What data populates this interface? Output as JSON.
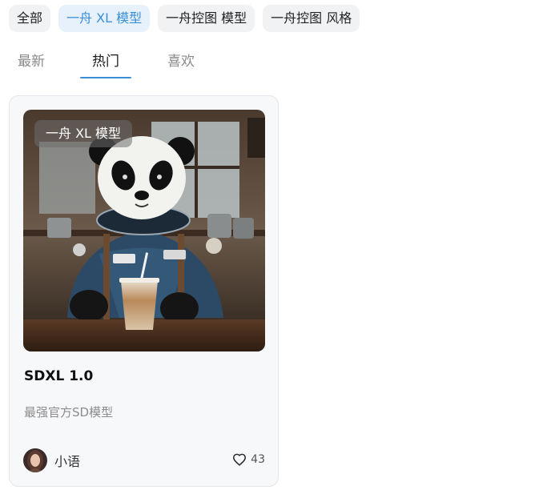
{
  "filters": {
    "chips": [
      {
        "label": "全部"
      },
      {
        "label": "一舟 XL 模型",
        "active": true
      },
      {
        "label": "一舟控图 模型"
      },
      {
        "label": "一舟控图 风格"
      }
    ]
  },
  "tabs": [
    {
      "label": "最新"
    },
    {
      "label": "热门",
      "active": true
    },
    {
      "label": "喜欢"
    }
  ],
  "card": {
    "badge": "一舟 XL 模型",
    "image_icon": "panda-astronaut-image",
    "title": "SDXL 1.0",
    "description": "最强官方SD模型",
    "author": {
      "name": "小语",
      "avatar_icon": "user-avatar-icon"
    },
    "likes": {
      "count": "43",
      "icon": "heart-outline-icon"
    }
  },
  "colors": {
    "accent": "#3a8fd6",
    "chip_bg": "#f1f2f4",
    "chip_active_bg": "#e6f1fb",
    "card_bg": "#f7f8fa"
  }
}
